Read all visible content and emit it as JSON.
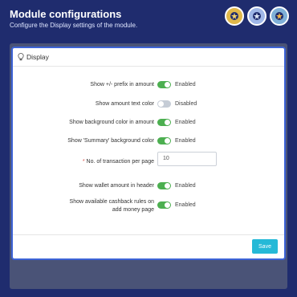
{
  "header": {
    "title": "Module configurations",
    "subtitle": "Configure the Display settings of the module."
  },
  "badges": [
    "gold-badge-icon",
    "silver-badge-icon",
    "blue-badge-icon"
  ],
  "panel": {
    "title": "Display",
    "rows": [
      {
        "label": "Show +/- prefix in amount",
        "state": "Enabled",
        "on": true
      },
      {
        "label": "Show amount text color",
        "state": "Disabled",
        "on": false
      },
      {
        "label": "Show background color in amount",
        "state": "Enabled",
        "on": true
      },
      {
        "label": "Show 'Summary' background color",
        "state": "Enabled",
        "on": true
      },
      {
        "label": "No. of transaction per page",
        "required": "*",
        "value": "10"
      },
      {
        "label": "Show wallet amount in header",
        "state": "Enabled",
        "on": true
      },
      {
        "label_line1": "Show available cashback rules on",
        "label_line2": "add money page",
        "state": "Enabled",
        "on": true
      }
    ],
    "save_label": "Save"
  },
  "colors": {
    "background": "#1f2c6e",
    "panel_border": "#3d63d6",
    "toggle_on": "#4caf50",
    "toggle_off": "#c5ccd6",
    "save_button": "#25b9d7"
  }
}
